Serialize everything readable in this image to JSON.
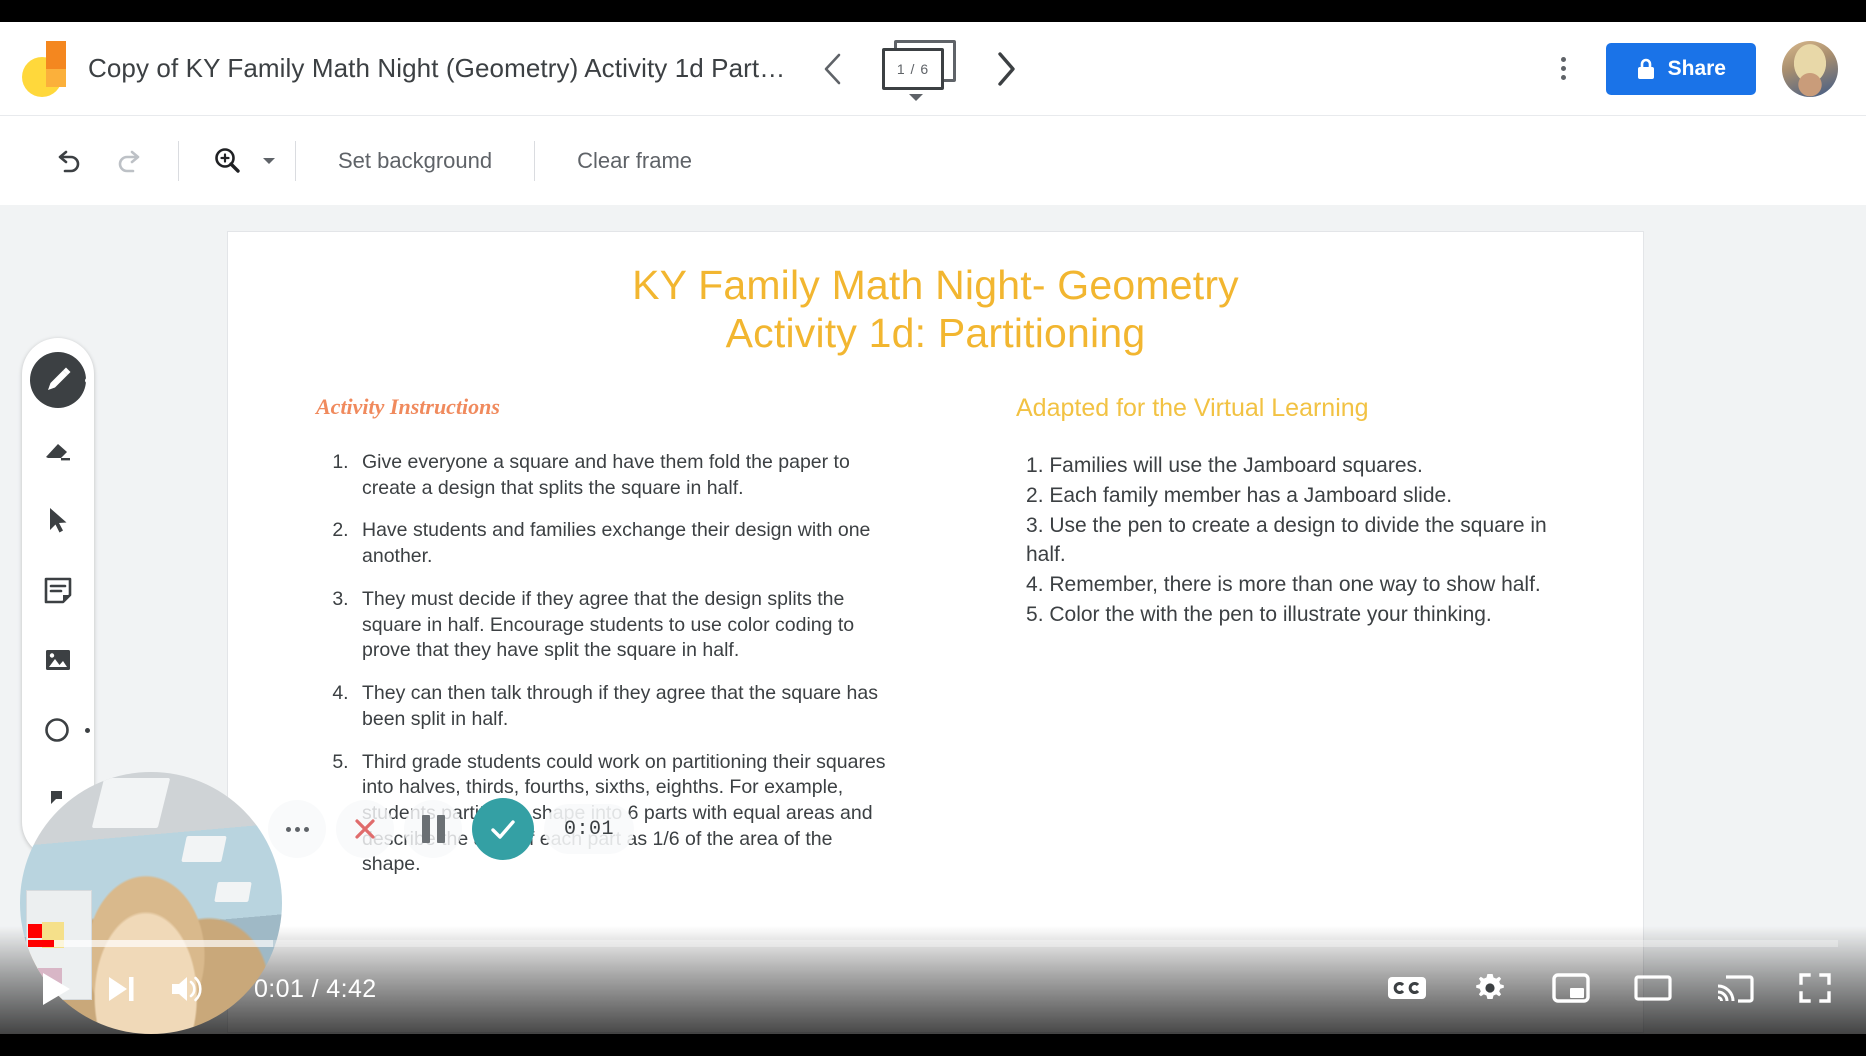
{
  "app": {
    "name": "Jamboard",
    "logo_icon": "jamboard-logo",
    "document_title": "Copy of KY Family Math Night (Geometry) Activity 1d Parti…"
  },
  "header": {
    "prev_frame_icon": "chevron-left-icon",
    "next_frame_icon": "chevron-right-icon",
    "frame_counter": "1 / 6",
    "frame_counter_caret_icon": "caret-down-icon",
    "more_menu_icon": "kebab-menu-icon",
    "share_label": "Share",
    "share_lock_icon": "lock-icon",
    "share_color": "#1a73e8",
    "avatar_icon": "user-avatar"
  },
  "toolbar": {
    "undo_icon": "undo-icon",
    "redo_icon": "redo-icon",
    "zoom_icon": "zoom-in-icon",
    "zoom_caret_icon": "caret-down-icon",
    "set_background_label": "Set background",
    "clear_frame_label": "Clear frame"
  },
  "tool_rail": {
    "items": [
      {
        "name": "pen",
        "icon": "pen-icon",
        "active": true
      },
      {
        "name": "eraser",
        "icon": "eraser-icon",
        "active": false
      },
      {
        "name": "select",
        "icon": "cursor-select-icon",
        "active": false
      },
      {
        "name": "sticky-note",
        "icon": "sticky-note-icon",
        "active": false
      },
      {
        "name": "image",
        "icon": "image-icon",
        "active": false
      },
      {
        "name": "shape",
        "icon": "circle-shape-icon",
        "active": false
      },
      {
        "name": "laser",
        "icon": "laser-pointer-icon",
        "active": false
      }
    ]
  },
  "slide": {
    "title_line1": "KY Family Math Night- Geometry",
    "title_line2": "Activity 1d: Partitioning",
    "title_color": "#f2b630",
    "left": {
      "heading": "Activity Instructions",
      "heading_color": "#f08a5d",
      "items": [
        "Give everyone a square and have them fold the paper to create a design that splits the square in half.",
        "Have students and families exchange their design with one another.",
        "They must decide if they agree that the design splits the square in half. Encourage students to use color coding to prove that they have split the square in half.",
        "They can then talk through if they agree that the square has been split in half.",
        "Third grade students could work on partitioning their squares into halves, thirds, fourths, sixths, eighths. For example, students partition a shape into 6 parts with equal areas and describe the area of each part as 1/6 of the area of the shape."
      ]
    },
    "right": {
      "heading": "Adapted for the Virtual Learning",
      "heading_color": "#f2c243",
      "items": [
        "Families will use the Jamboard squares.",
        "Each family member has a Jamboard slide.",
        "Use the pen to create a design to divide the square in half.",
        "Remember, there is more than one way to show half.",
        " Color the with the pen to illustrate your thinking."
      ]
    }
  },
  "recording_overlay": {
    "more_icon": "more-options-icon",
    "cancel_icon": "close-x-icon",
    "cancel_color": "#e06c6c",
    "pause_icon": "pause-icon",
    "accept_icon": "check-icon",
    "accept_color": "#34a0a4",
    "elapsed": "0:01"
  },
  "player": {
    "play_icon": "play-icon",
    "next_icon": "next-track-icon",
    "volume_icon": "volume-icon",
    "time_display": "0:01 / 4:42",
    "captions_icon": "closed-captions-icon",
    "settings_icon": "gear-icon",
    "miniplayer_icon": "miniplayer-icon",
    "theater_icon": "theater-mode-icon",
    "cast_icon": "cast-icon",
    "fullscreen_icon": "fullscreen-icon",
    "progress_percent": 1,
    "buffered_percent": 13,
    "progress_color": "#ff0000"
  }
}
